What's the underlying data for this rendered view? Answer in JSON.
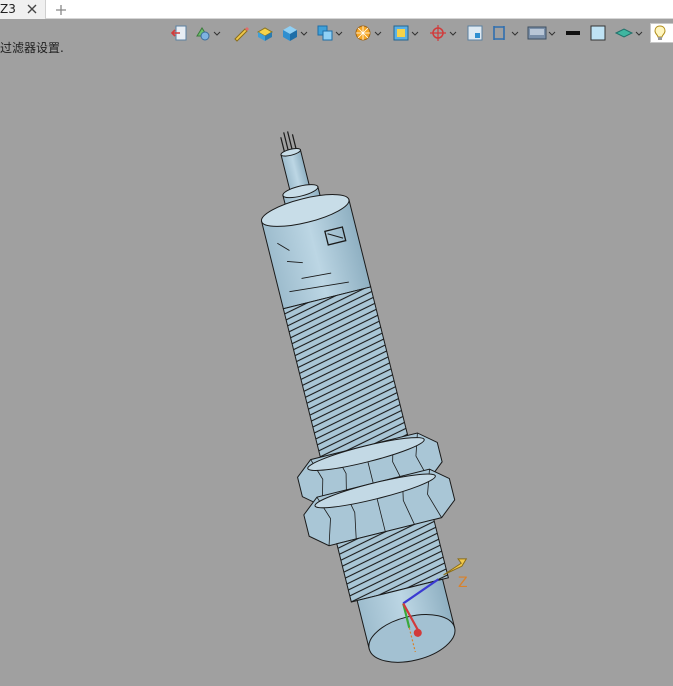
{
  "tab": {
    "label": "Z3",
    "close_glyph": "✕",
    "new_glyph": "+"
  },
  "hint_text": "过滤器设置.",
  "toolbar": {
    "items": [
      {
        "name": "exit-icon"
      },
      {
        "name": "filter-icon"
      },
      {
        "name": "pencil-icon"
      },
      {
        "name": "part-icon"
      },
      {
        "name": "cube-icon"
      },
      {
        "name": "copy-icon"
      },
      {
        "name": "render-icon"
      },
      {
        "name": "view-icon"
      },
      {
        "name": "axis-icon"
      },
      {
        "name": "grid-icon"
      },
      {
        "name": "section-icon"
      },
      {
        "name": "display-icon"
      },
      {
        "name": "line-style-icon"
      },
      {
        "name": "fill-color-icon"
      },
      {
        "name": "layer-icon"
      },
      {
        "name": "light-bulb-icon"
      }
    ]
  },
  "axis": {
    "z_label": "Z"
  },
  "colors": {
    "background": "#a0a0a0",
    "model_fill": "#a9c6d6",
    "model_edge": "#1a1a1a",
    "axis_x": "#d23a3a",
    "axis_y": "#3aa83a",
    "axis_z": "#3a3ad2",
    "axis_label": "#d9822b"
  }
}
